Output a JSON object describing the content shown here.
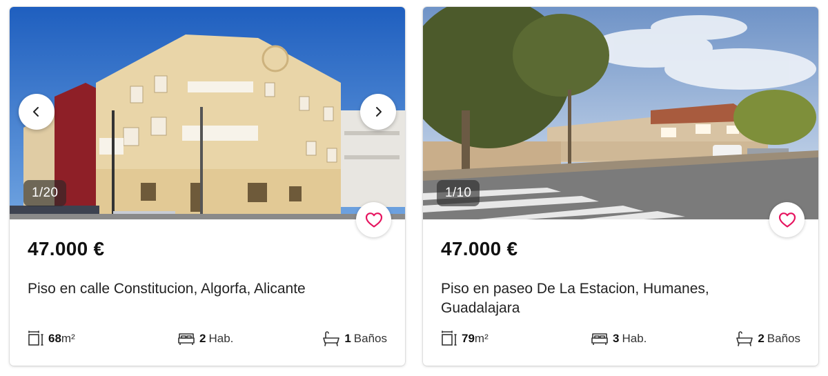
{
  "listings": [
    {
      "photo_counter": "1/20",
      "price": "47.000 €",
      "title": "Piso en calle Constitucion, Algorfa, Alicante",
      "area_value": "68",
      "area_unit": "m²",
      "rooms_value": "2",
      "rooms_label": "Hab.",
      "baths_value": "1",
      "baths_label": "Baños"
    },
    {
      "photo_counter": "1/10",
      "price": "47.000 €",
      "title": "Piso en paseo De La Estacion, Humanes, Guadalajara",
      "area_value": "79",
      "area_unit": "m²",
      "rooms_value": "3",
      "rooms_label": "Hab.",
      "baths_value": "2",
      "baths_label": "Baños"
    }
  ],
  "icons": {
    "prev": "chevron-left-icon",
    "next": "chevron-right-icon",
    "favorite": "heart-icon",
    "area": "area-icon",
    "rooms": "bed-icon",
    "baths": "bathtub-icon"
  },
  "colors": {
    "accent": "#e6145f",
    "text": "#111111",
    "counter_bg": "#282828"
  }
}
